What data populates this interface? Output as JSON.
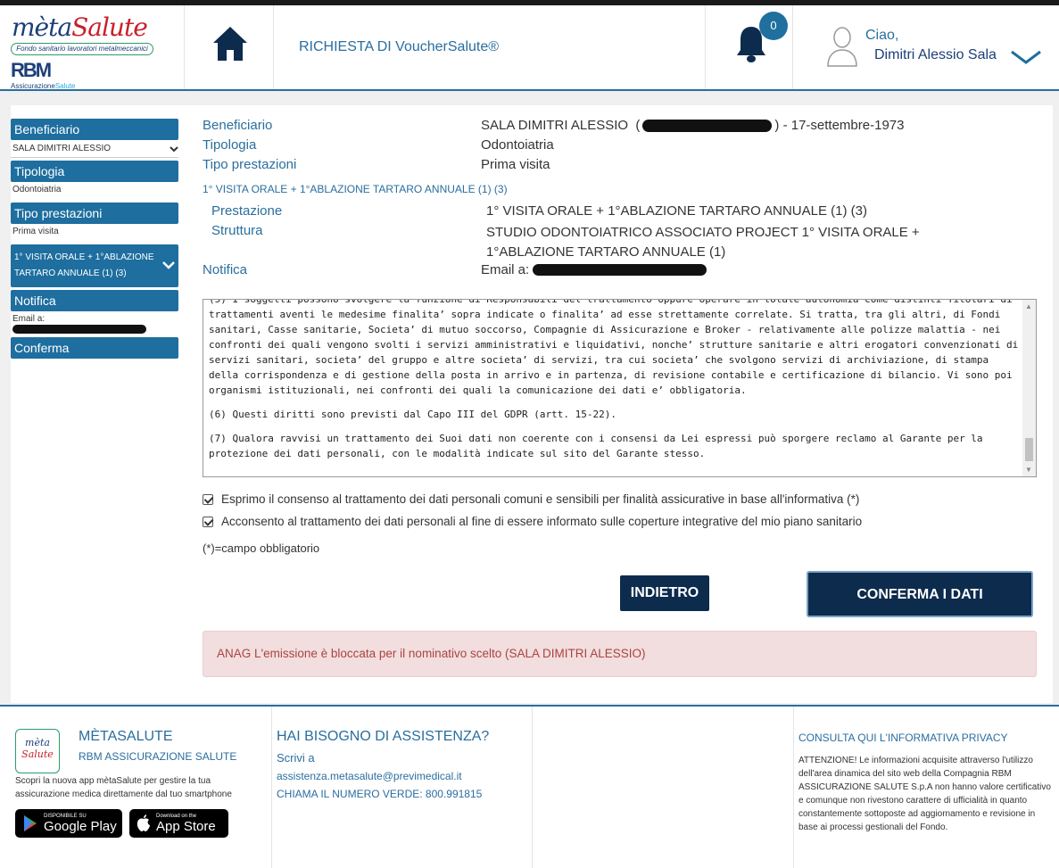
{
  "header": {
    "brand": {
      "meta": "mèta",
      "salute": "Salute",
      "tagline": "Fondo sanitario lavoratori metalmeccanici",
      "rbm": "RBM",
      "rbm_sub_a": "Assicurazione",
      "rbm_sub_b": "Salute"
    },
    "page_title": "RICHIESTA DI VoucherSalute®",
    "notifications_count": "0",
    "greeting": "Ciao,",
    "user_name": "Dimitri Alessio  Sala"
  },
  "sidebar": {
    "beneficiario_label": "Beneficiario",
    "beneficiario_value": "SALA DIMITRI ALESSIO",
    "tipologia_label": "Tipologia",
    "tipologia_value": "Odontoiatria",
    "tipo_prestazioni_label": "Tipo prestazioni",
    "tipo_prestazioni_value": "Prima visita",
    "prestazione_label": "1° VISITA ORALE + 1°ABLAZIONE TARTARO ANNUALE (1) (3)",
    "notifica_label": "Notifica",
    "notifica_value": "Email a:",
    "conferma_label": "Conferma"
  },
  "summary": {
    "beneficiario_label": "Beneficiario",
    "beneficiario_name": "SALA DIMITRI ALESSIO",
    "beneficiario_dob": ") - 17-settembre-1973",
    "tipologia_label": "Tipologia",
    "tipologia_value": "Odontoiatria",
    "tipo_prestazioni_label": "Tipo prestazioni",
    "tipo_prestazioni_value": "Prima visita",
    "section_title": "1° VISITA ORALE + 1°ABLAZIONE TARTARO ANNUALE (1) (3)",
    "prestazione_label": "Prestazione",
    "prestazione_value": "1° VISITA ORALE + 1°ABLAZIONE TARTARO ANNUALE (1) (3)",
    "struttura_label": "Struttura",
    "struttura_value": "STUDIO ODONTOIATRICO ASSOCIATO PROJECT 1° VISITA ORALE + 1°ABLAZIONE TARTARO ANNUALE (1)",
    "notifica_label": "Notifica",
    "notifica_value": "Email a:"
  },
  "privacy": {
    "p5": "(5) I soggetti possono svolgere la funzione di Responsabili del trattamento oppure operare in totale autonomia come distinti Titolari di trattamenti aventi le medesime finalita’ sopra indicate o finalita’ ad esse strettamente correlate. Si tratta, tra gli altri, di Fondi sanitari, Casse sanitarie, Societa’ di mutuo soccorso, Compagnie di Assicurazione e Broker - relativamente alle polizze malattia - nei confronti dei quali vengono svolti i servizi amministrativi e liquidativi, nonche’ strutture sanitarie e altri erogatori convenzionati di servizi sanitari, societa’ del gruppo e altre societa’ di servizi, tra cui societa’ che svolgono servizi di archiviazione, di stampa della corrispondenza e di gestione della posta in arrivo e in partenza, di revisione contabile e certificazione di bilancio. Vi sono poi organismi istituzionali, nei confronti dei quali la comunicazione dei dati e’ obbligatoria.",
    "p6": "(6) Questi diritti sono previsti dal Capo III del GDPR (artt. 15-22).",
    "p7": "(7) Qualora ravvisi un trattamento dei Suoi dati non coerente con i consensi da Lei espressi può sporgere reclamo al Garante per la protezione dei dati personali, con le modalità indicate sul sito del Garante stesso."
  },
  "consents": {
    "consent1": "Esprimo il consenso al trattamento dei dati personali comuni e sensibili per finalità assicurative in base all'informativa (*)",
    "consent2": "Acconsento al trattamento dei dati personali al fine di essere informato sulle coperture integrative del mio piano sanitario",
    "required_note": "(*)=campo obbligatorio"
  },
  "buttons": {
    "back": "INDIETRO",
    "confirm": "CONFERMA I DATI"
  },
  "alert": "ANAG L'emissione è bloccata per il nominativo scelto (SALA DIMITRI ALESSIO)",
  "footer": {
    "app_logo_a": "mèta",
    "app_logo_b": "Salute",
    "brand_title": "MÈTASALUTE",
    "brand_sub": "RBM ASSICURAZIONE SALUTE",
    "app_text": "Scopri la nuova app mètaSalute per gestire la tua assicurazione medica direttamente dal tuo smartphone",
    "gplay_small": "DISPONIBILE SU",
    "gplay_big": "Google Play",
    "astore_small": "Download on the",
    "astore_big": "App Store",
    "help_title": "HAI BISOGNO DI ASSISTENZA?",
    "write": "Scrivi a",
    "email": "assistenza.metasalute@previmedical.it",
    "call": "CHIAMA IL NUMERO VERDE: 800.991815",
    "privacy_link": "CONSULTA QUI  L'INFORMATIVA PRIVACY",
    "disclaimer": "ATTENZIONE! Le informazioni acquisite attraverso l'utilizzo dell'area dinamica del sito web della Compagnia RBM ASSICURAZIONE SALUTE S.p.A non hanno valore certificativo e comunque non rivestono carattere di ufficialità in quanto constantemente sottoposte ad aggiornamento e revisione in base ai processi gestionali del Fondo."
  },
  "colors": {
    "primary": "#1e6e9f",
    "dark_button": "#0d2b4d",
    "link": "#2a6e9e",
    "alert_bg": "#f2dede",
    "alert_text": "#a94442"
  }
}
